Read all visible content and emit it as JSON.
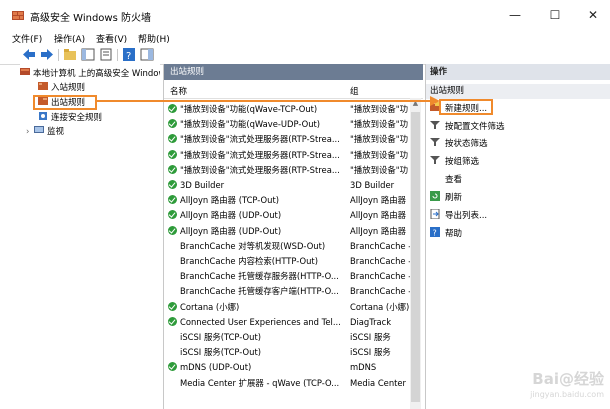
{
  "window": {
    "title": "高级安全 Windows 防火墙",
    "minimize": "—",
    "maximize": "☐",
    "close": "✕"
  },
  "menu": [
    "文件(F)",
    "操作(A)",
    "查看(V)",
    "帮助(H)"
  ],
  "tree": {
    "root": "本地计算机 上的高级安全 Windows",
    "items": [
      "入站规则",
      "出站规则",
      "连接安全规则",
      "监视"
    ]
  },
  "center": {
    "header": "出站规则",
    "columns": [
      "名称",
      "组"
    ],
    "rows": [
      {
        "name": "\"播放到设备\"功能(qWave-TCP-Out)",
        "group": "\"播放到设备\"功",
        "enabled": true
      },
      {
        "name": "\"播放到设备\"功能(qWave-UDP-Out)",
        "group": "\"播放到设备\"功",
        "enabled": true
      },
      {
        "name": "\"播放到设备\"流式处理服务器(RTP-Strea...",
        "group": "\"播放到设备\"功",
        "enabled": true
      },
      {
        "name": "\"播放到设备\"流式处理服务器(RTP-Strea...",
        "group": "\"播放到设备\"功",
        "enabled": true
      },
      {
        "name": "\"播放到设备\"流式处理服务器(RTP-Strea...",
        "group": "\"播放到设备\"功",
        "enabled": true
      },
      {
        "name": "3D Builder",
        "group": "3D Builder",
        "enabled": true
      },
      {
        "name": "AllJoyn 路由器 (TCP-Out)",
        "group": "AllJoyn 路由器",
        "enabled": true
      },
      {
        "name": "AllJoyn 路由器 (UDP-Out)",
        "group": "AllJoyn 路由器",
        "enabled": true
      },
      {
        "name": "AllJoyn 路由器 (UDP-Out)",
        "group": "AllJoyn 路由器",
        "enabled": true
      },
      {
        "name": "BranchCache 对等机发现(WSD-Out)",
        "group": "BranchCache -",
        "enabled": false
      },
      {
        "name": "BranchCache 内容检索(HTTP-Out)",
        "group": "BranchCache -",
        "enabled": false
      },
      {
        "name": "BranchCache 托管缓存服务器(HTTP-O...",
        "group": "BranchCache -",
        "enabled": false
      },
      {
        "name": "BranchCache 托管缓存客户端(HTTP-O...",
        "group": "BranchCache -",
        "enabled": false
      },
      {
        "name": "Cortana (小娜)",
        "group": "Cortana (小娜)",
        "enabled": true
      },
      {
        "name": "Connected User Experiences and Tel...",
        "group": "DiagTrack",
        "enabled": true
      },
      {
        "name": "iSCSI 服务(TCP-Out)",
        "group": "iSCSI 服务",
        "enabled": false
      },
      {
        "name": "iSCSI 服务(TCP-Out)",
        "group": "iSCSI 服务",
        "enabled": false
      },
      {
        "name": "mDNS (UDP-Out)",
        "group": "mDNS",
        "enabled": true
      },
      {
        "name": "Media Center 扩展器 - qWave (TCP-O...",
        "group": "Media Center",
        "enabled": false
      }
    ]
  },
  "actions": {
    "header": "操作",
    "section": "出站规则",
    "items": [
      "新建规则...",
      "按配置文件筛选",
      "按状态筛选",
      "按组筛选",
      "查看",
      "刷新",
      "导出列表...",
      "帮助"
    ]
  },
  "watermark": {
    "brand": "Bai@经验",
    "url": "jingyan.baidu.com"
  },
  "colors": {
    "accent": "#f08a2c",
    "header": "#6c7c93",
    "enabled": "#2e9b3a"
  }
}
